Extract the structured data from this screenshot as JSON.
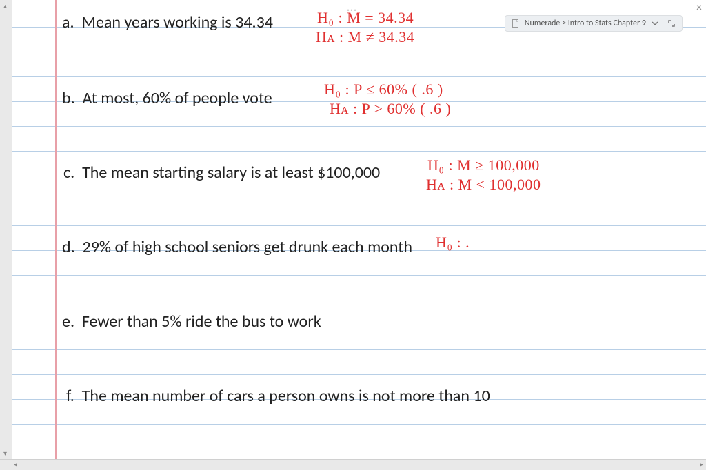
{
  "breadcrumb": {
    "text": "Numerade > Intro to Stats Chapter 9",
    "chevron_icon": "chevron-down",
    "expand_icon": "expand-icon",
    "page_icon": "page-icon"
  },
  "top_ellipsis": "…",
  "items": {
    "a": {
      "label": "a.",
      "text": "Mean years working is 34.34"
    },
    "b": {
      "label": "b.",
      "text": "At most, 60% of people vote"
    },
    "c": {
      "label": "c.",
      "text": "The mean starting salary is at least $100,000"
    },
    "d": {
      "label": "d.",
      "text": "29% of high school seniors get drunk each month"
    },
    "e": {
      "label": "e.",
      "text": "Fewer than 5% ride the bus to work"
    },
    "f": {
      "label": "f.",
      "text": "The mean number of cars a person owns is not more than 10"
    }
  },
  "hand": {
    "a_h0": "H₀ : M = 34.34",
    "a_ha": "Hᴀ : M ≠ 34.34",
    "b_h0": "H₀ : P ≤ 60% ( .6 )",
    "b_ha": "Hᴀ : P > 60% ( .6 )",
    "c_h0": "H₀ : M ≥ 100,000",
    "c_ha": "Hᴀ : M < 100,000",
    "d_h0": "H₀ : ."
  },
  "close_label": "×"
}
